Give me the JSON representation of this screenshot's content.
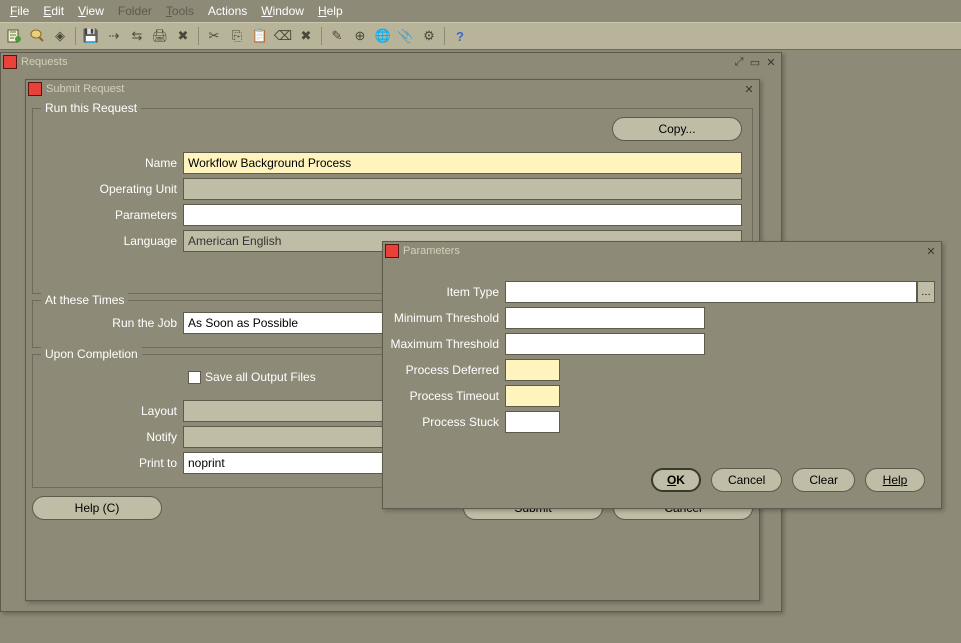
{
  "menubar": {
    "file": "File",
    "edit": "Edit",
    "view": "View",
    "folder": "Folder",
    "tools": "Tools",
    "actions": "Actions",
    "window": "Window",
    "help": "Help"
  },
  "requests_window": {
    "title": "Requests"
  },
  "submit_window": {
    "title": "Submit Request",
    "group_run": "Run this Request",
    "copy_btn": "Copy...",
    "name_label": "Name",
    "name_value": "Workflow Background Process",
    "ou_label": "Operating Unit",
    "ou_value": "",
    "params_label": "Parameters",
    "params_value": "",
    "lang_label": "Language",
    "lang_value": "American English",
    "group_times": "At these Times",
    "run_job_label": "Run the Job",
    "run_job_value": "As Soon as Possible",
    "group_completion": "Upon Completion",
    "save_output_label": "Save all Output Files",
    "layout_label": "Layout",
    "layout_value": "",
    "notify_label": "Notify",
    "notify_value": "",
    "print_label": "Print to",
    "print_value": "noprint",
    "help_btn": "Help (C)",
    "submit_btn": "Submit",
    "cancel_btn": "Cancel"
  },
  "params_window": {
    "title": "Parameters",
    "item_type_label": "Item Type",
    "item_type_value": "",
    "min_thresh_label": "Minimum Threshold",
    "min_thresh_value": "",
    "max_thresh_label": "Maximum Threshold",
    "max_thresh_value": "",
    "proc_def_label": "Process Deferred",
    "proc_def_value": "",
    "proc_timeout_label": "Process Timeout",
    "proc_timeout_value": "",
    "proc_stuck_label": "Process Stuck",
    "proc_stuck_value": "",
    "ok_btn": "OK",
    "cancel_btn": "Cancel",
    "clear_btn": "Clear",
    "help_btn": "Help"
  }
}
